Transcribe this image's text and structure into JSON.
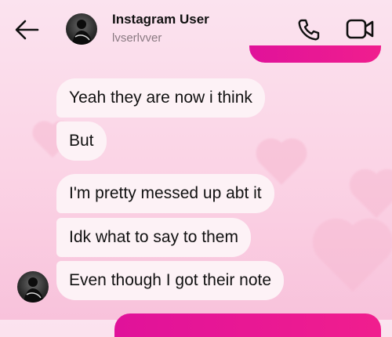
{
  "header": {
    "title": "Instagram User",
    "username": "lvserlvver"
  },
  "messages": [
    {
      "text": "Yeah they are now i think"
    },
    {
      "text": "But"
    },
    {
      "text": "I'm pretty messed up abt it"
    },
    {
      "text": "Idk what to say to them"
    },
    {
      "text": "Even though I got their note"
    }
  ],
  "icons": {
    "back": "back-arrow-icon",
    "call": "phone-icon",
    "video": "video-camera-icon"
  },
  "colors": {
    "sent_bubble": "#e0129a",
    "received_bubble": "#fdf2f6",
    "background": "#fbd3e5"
  }
}
